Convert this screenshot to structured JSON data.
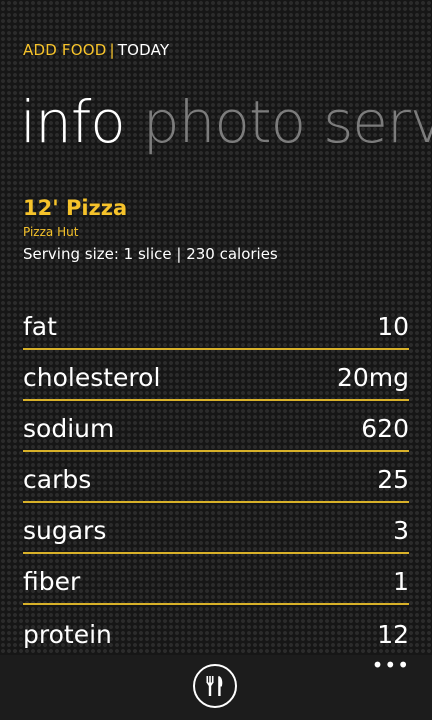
{
  "header": {
    "app_title": "ADD FOOD",
    "separator": "|",
    "page_title": "TODAY"
  },
  "pivot": {
    "tabs": [
      {
        "label": "info",
        "active": true
      },
      {
        "label": "photo",
        "active": false
      },
      {
        "label": "serv",
        "active": false
      }
    ]
  },
  "food": {
    "name": "12' Pizza",
    "brand": "Pizza Hut",
    "serving": "Serving size: 1 slice | 230 calories"
  },
  "nutrients": [
    {
      "label": "fat",
      "value": "10"
    },
    {
      "label": "cholesterol",
      "value": "20mg"
    },
    {
      "label": "sodium",
      "value": "620"
    },
    {
      "label": "carbs",
      "value": "25"
    },
    {
      "label": "sugars",
      "value": "3"
    },
    {
      "label": "fiber",
      "value": "1"
    },
    {
      "label": "protein",
      "value": "12"
    }
  ],
  "appbar": {
    "button_icon": "fork-knife-icon",
    "more_label": "•••"
  },
  "colors": {
    "accent": "#f6c32b",
    "background": "#161616",
    "inactive_pivot": "#7c7c7c"
  }
}
